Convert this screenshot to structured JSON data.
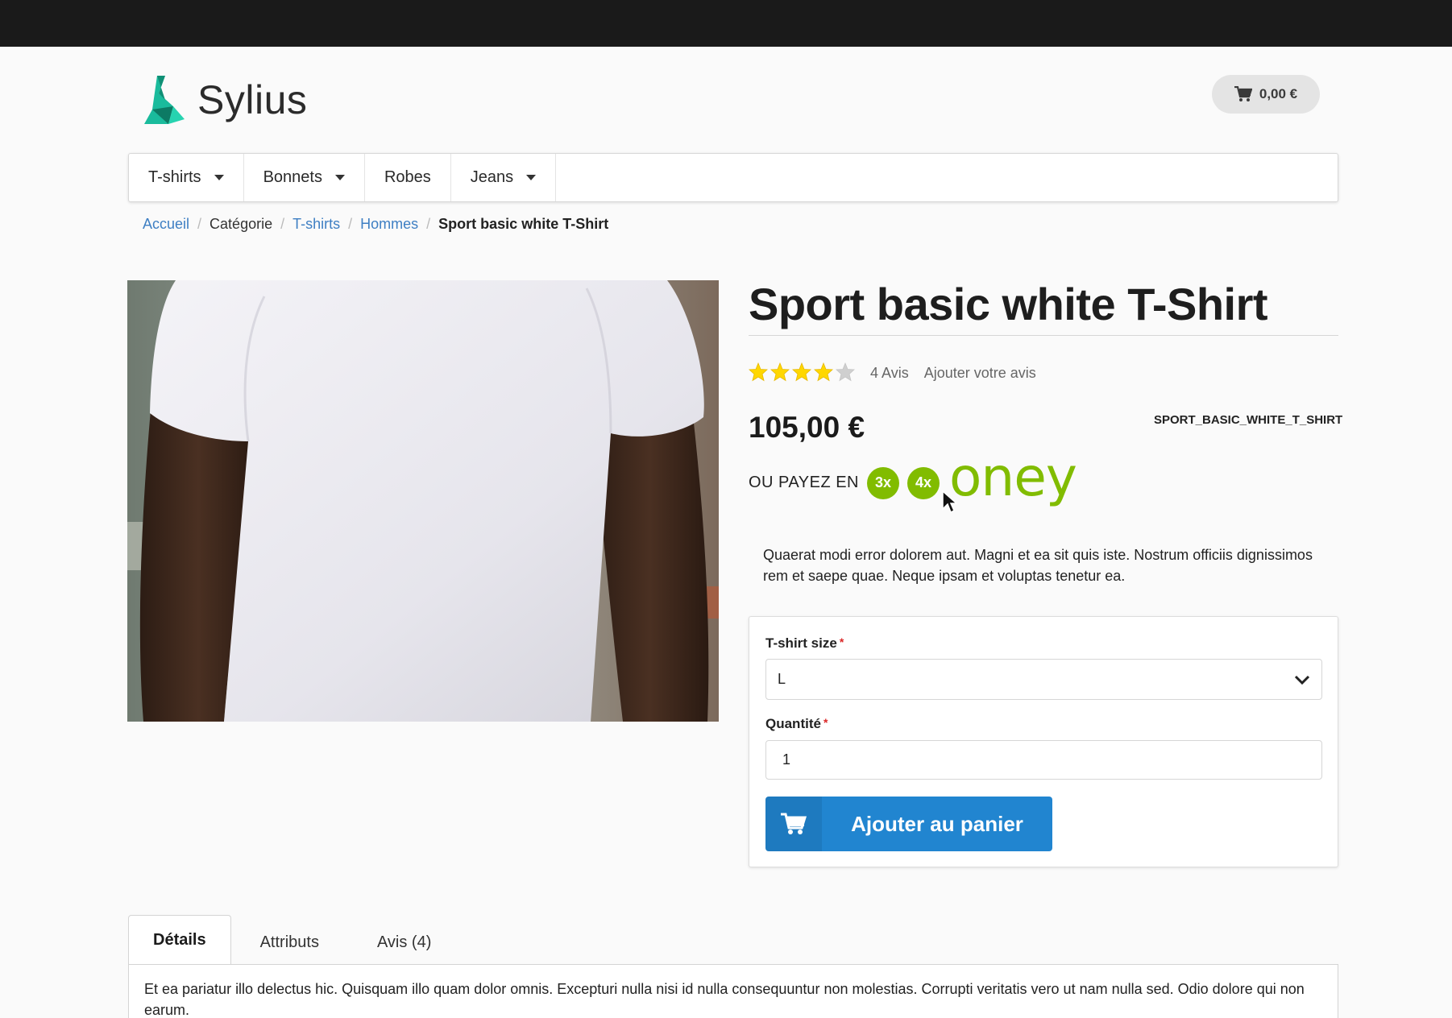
{
  "header": {
    "logo_text": "Sylius",
    "cart_total": "0,00 €"
  },
  "nav": {
    "items": [
      {
        "label": "T-shirts",
        "has_dropdown": true
      },
      {
        "label": "Bonnets",
        "has_dropdown": true
      },
      {
        "label": "Robes",
        "has_dropdown": false
      },
      {
        "label": "Jeans",
        "has_dropdown": true
      }
    ]
  },
  "breadcrumb": {
    "home": "Accueil",
    "category": "Catégorie",
    "tshirts": "T-shirts",
    "men": "Hommes",
    "current": "Sport basic white T-Shirt"
  },
  "product": {
    "title": "Sport basic white T-Shirt",
    "rating": 4,
    "rating_max": 5,
    "reviews_count_label": "4 Avis",
    "add_review_label": "Ajouter votre avis",
    "price": "105,00 €",
    "sku": "SPORT_BASIC_WHITE_T_SHIRT",
    "description": "Quaerat modi error dolorem aut. Magni et ea sit quis iste. Nostrum officiis dignissimos rem et saepe quae. Neque ipsam et voluptas tenetur ea."
  },
  "oney": {
    "label": "OU PAYEZ EN",
    "badge_3x": "3x",
    "badge_4x": "4x",
    "brand": "oney",
    "color": "#81bc00"
  },
  "form": {
    "size_label": "T-shirt size",
    "size_value": "L",
    "quantity_label": "Quantité",
    "quantity_value": "1",
    "required_mark": "*",
    "add_to_cart_label": "Ajouter au panier"
  },
  "tabs": {
    "items": [
      {
        "label": "Détails",
        "active": true
      },
      {
        "label": "Attributs",
        "active": false
      },
      {
        "label": "Avis (4)",
        "active": false
      }
    ],
    "details_text": "Et ea pariatur illo delectus hic. Quisquam illo quam dolor omnis. Excepturi nulla nisi id nulla consequuntur non molestias. Corrupti veritatis vero ut nam nulla sed. Odio dolore qui non earum."
  },
  "colors": {
    "accent_blue": "#2185d0",
    "link_blue": "#3e7fc3",
    "star_yellow": "#ffd700",
    "star_grey": "#cfcfcf"
  }
}
